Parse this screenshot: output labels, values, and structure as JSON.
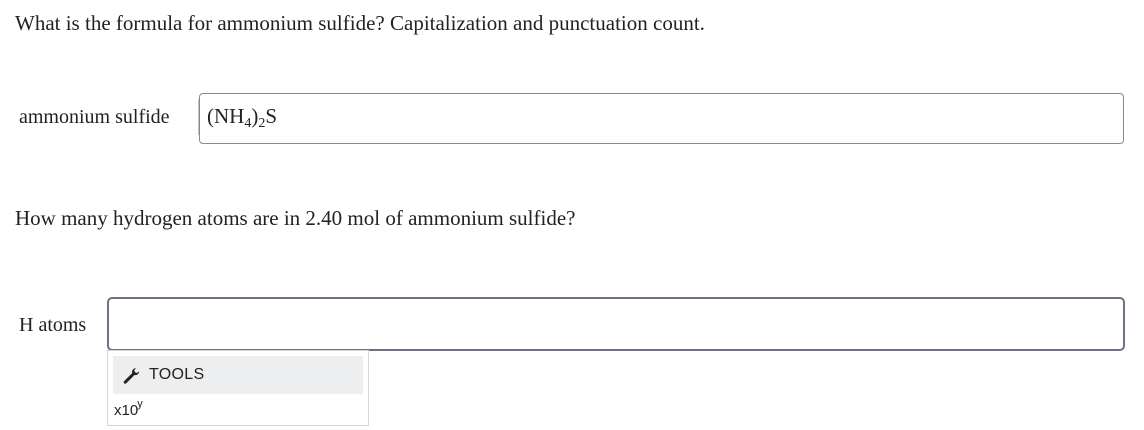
{
  "question1": {
    "text": "What is the formula for ammonium sulfide? Capitalization and punctuation count."
  },
  "answer1": {
    "label": "ammonium sulfide",
    "formula": {
      "open": "(NH",
      "sub1": "4",
      "close": ")",
      "sub2": "2",
      "tail": "S"
    }
  },
  "question2": {
    "text": "How many hydrogen atoms are in 2.40 mol of ammonium sulfide?"
  },
  "answer2": {
    "label": "H atoms",
    "value": "",
    "placeholder": ""
  },
  "tools": {
    "icon": "wrench-icon",
    "label": "TOOLS",
    "x10_base": "x10",
    "x10_exponent": "y"
  },
  "colors": {
    "text": "#222222",
    "input_border": "#6b7380",
    "tools_header_bg": "#eceef0"
  }
}
